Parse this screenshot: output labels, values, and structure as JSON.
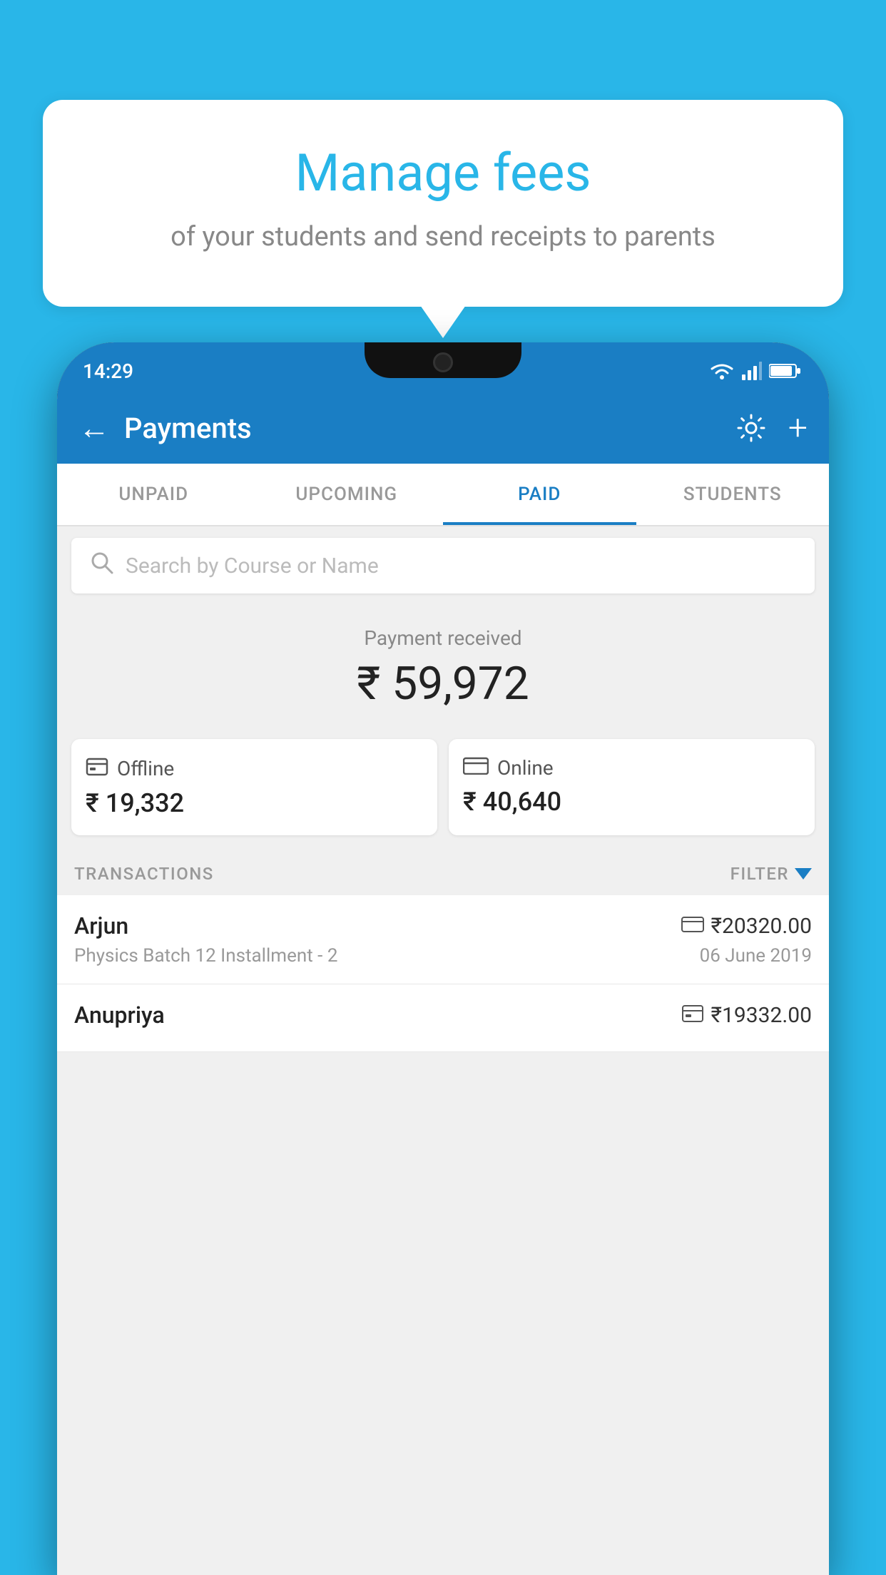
{
  "background_color": "#29b6e8",
  "tooltip": {
    "title": "Manage fees",
    "subtitle": "of your students and send receipts to parents"
  },
  "status_bar": {
    "time": "14:29",
    "icons": [
      "wifi",
      "signal",
      "battery"
    ]
  },
  "app_bar": {
    "title": "Payments",
    "back_icon": "←",
    "settings_icon": "⚙",
    "add_icon": "+"
  },
  "tabs": [
    {
      "label": "UNPAID",
      "active": false
    },
    {
      "label": "UPCOMING",
      "active": false
    },
    {
      "label": "PAID",
      "active": true
    },
    {
      "label": "STUDENTS",
      "active": false
    }
  ],
  "search": {
    "placeholder": "Search by Course or Name"
  },
  "payment_summary": {
    "label": "Payment received",
    "total_amount": "₹ 59,972",
    "offline_label": "Offline",
    "offline_amount": "₹ 19,332",
    "online_label": "Online",
    "online_amount": "₹ 40,640"
  },
  "transactions": {
    "label": "TRANSACTIONS",
    "filter_label": "FILTER",
    "items": [
      {
        "name": "Arjun",
        "course": "Physics Batch 12 Installment - 2",
        "amount": "₹20320.00",
        "date": "06 June 2019",
        "payment_type": "online"
      },
      {
        "name": "Anupriya",
        "course": "",
        "amount": "₹19332.00",
        "date": "",
        "payment_type": "offline"
      }
    ]
  }
}
